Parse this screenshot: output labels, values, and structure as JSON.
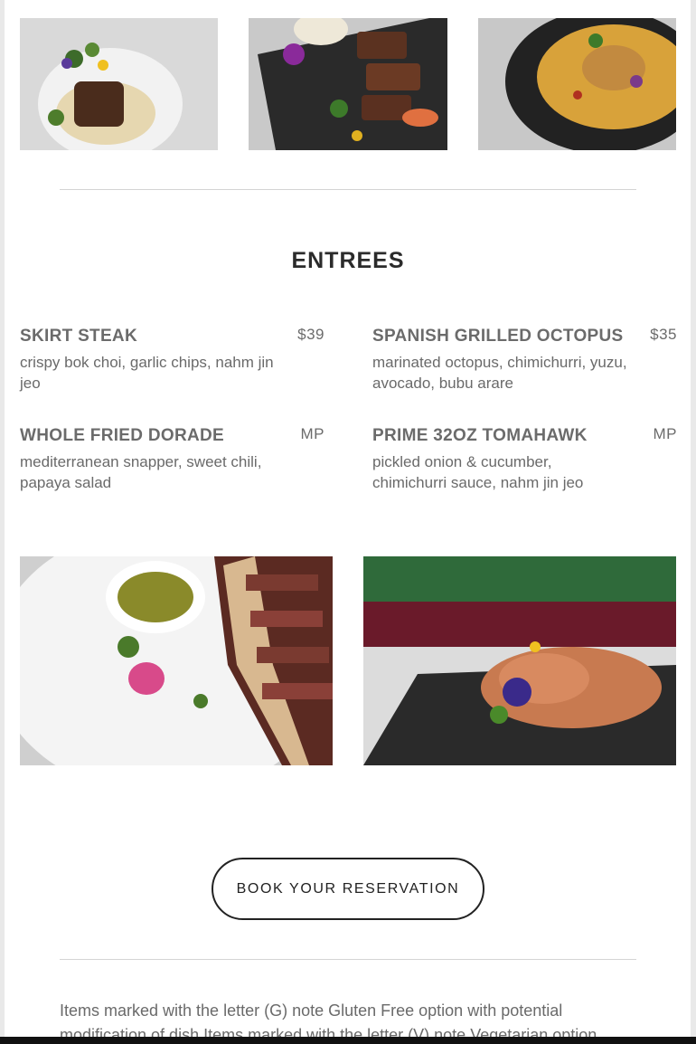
{
  "section": {
    "title": "ENTREES"
  },
  "items": [
    {
      "name": "SKIRT STEAK",
      "price": "$39",
      "description": "crispy bok choi, garlic chips, nahm jin jeo"
    },
    {
      "name": "SPANISH GRILLED OCTOPUS",
      "price": "$35",
      "description": "marinated octopus, chimichurri, yuzu, avocado, bubu arare"
    },
    {
      "name": "WHOLE FRIED DORADE",
      "price": "MP",
      "description": "mediterranean snapper, sweet chili, papaya salad"
    },
    {
      "name": "PRIME 32OZ TOMAHAWK",
      "price": "MP",
      "description": "pickled onion & cucumber, chimichurri sauce, nahm jin jeo"
    }
  ],
  "cta": {
    "label": "BOOK YOUR RESERVATION"
  },
  "footer": {
    "note": "Items marked with the letter (G) note Gluten Free option with potential modification of dish Items marked with the letter (V) note Vegetarian option"
  }
}
